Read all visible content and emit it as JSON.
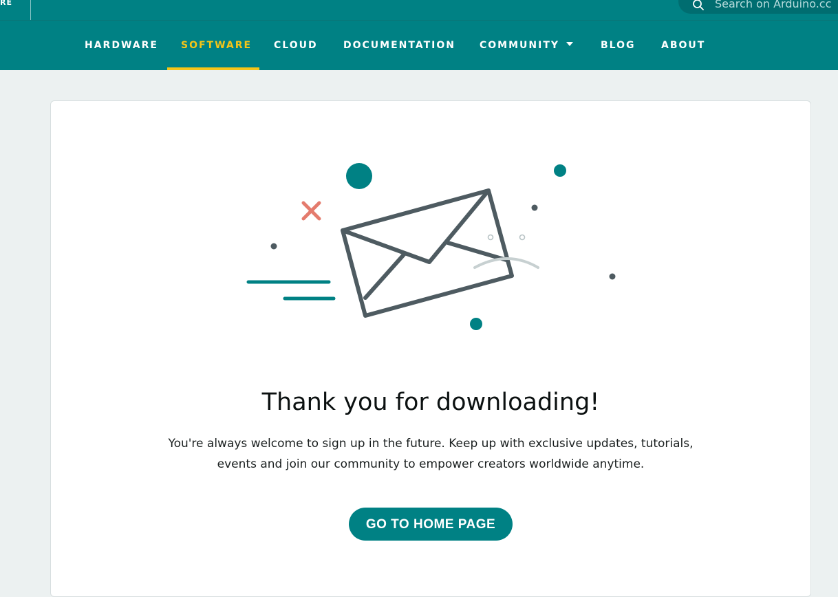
{
  "topbar": {
    "fragment_label": "RE",
    "search_placeholder": "Search on Arduino.cc"
  },
  "nav": {
    "items": [
      {
        "label": "HARDWARE"
      },
      {
        "label": "SOFTWARE",
        "active": true
      },
      {
        "label": "CLOUD"
      },
      {
        "label": "DOCUMENTATION"
      },
      {
        "label": "COMMUNITY",
        "has_dropdown": true
      },
      {
        "label": "BLOG"
      },
      {
        "label": "ABOUT"
      }
    ]
  },
  "main": {
    "title": "Thank you for downloading!",
    "message": "You're always welcome to sign up in the future. Keep up with exclusive updates, tutorials, events and join our community to empower creators worldwide anytime.",
    "home_button_label": "GO TO HOME PAGE"
  },
  "illustration": {
    "icon": "envelope-icon",
    "decorations": [
      "x-mark-icon",
      "dot",
      "circle",
      "speed-lines"
    ]
  },
  "colors": {
    "brand_teal": "#008184",
    "active_nav": "#f5c518",
    "page_background": "#ecf1f1",
    "envelope_stroke": "#4e5b61",
    "x_mark": "#e47b6d"
  }
}
